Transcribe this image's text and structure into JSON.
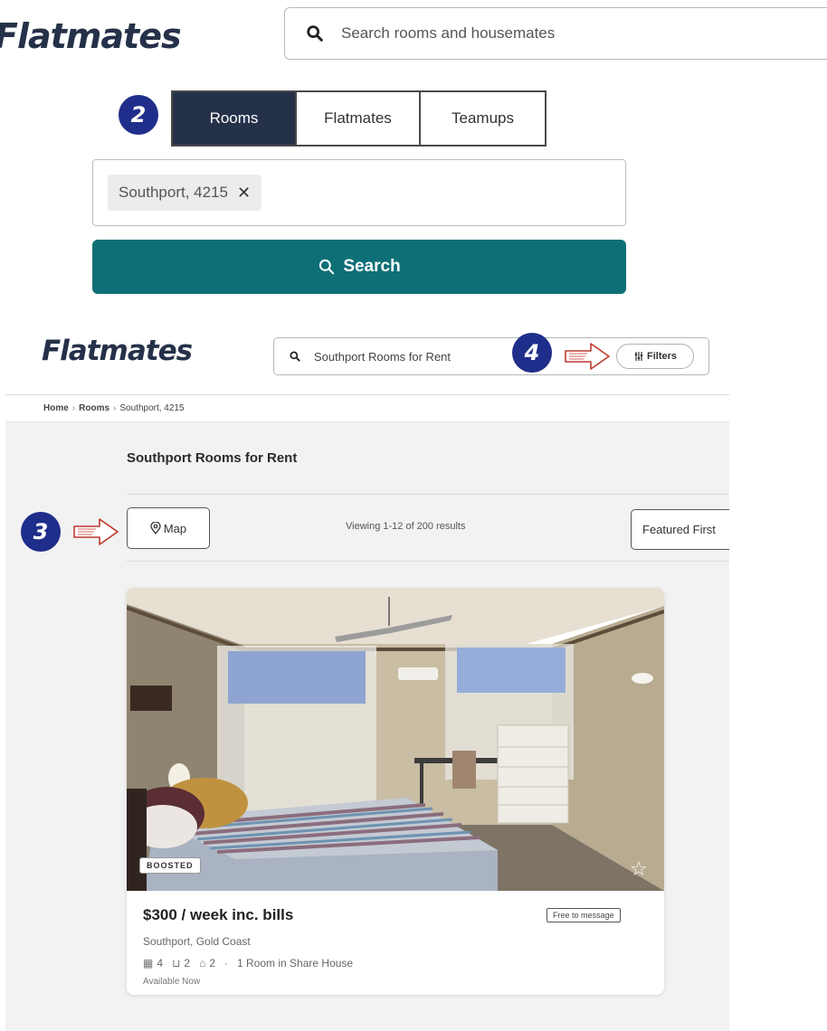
{
  "top": {
    "logo": "Flatmates",
    "search_placeholder": "Search rooms and housemates"
  },
  "steps": {
    "badge_2": "2",
    "badge_3": "3",
    "badge_4": "4"
  },
  "search_form": {
    "tabs": [
      {
        "label": "Rooms",
        "active": true
      },
      {
        "label": "Flatmates",
        "active": false
      },
      {
        "label": "Teamups",
        "active": false
      }
    ],
    "location_chip": "Southport, 4215",
    "search_button": "Search"
  },
  "header": {
    "logo": "Flatmates",
    "search_value": "Southport Rooms for Rent",
    "filters_label": "Filters"
  },
  "breadcrumb": [
    "Home",
    "Rooms",
    "Southport, 4215"
  ],
  "results": {
    "title": "Southport Rooms for Rent",
    "map_button": "Map",
    "viewing_text": "Viewing 1-12 of 200 results",
    "sort_label": "Featured First"
  },
  "listing": {
    "badge": "BOOSTED",
    "price": "$300 / week inc. bills",
    "free_to_message": "Free to message",
    "location": "Southport, Gold Coast",
    "bedrooms": "4",
    "bathrooms": "2",
    "parking": "2",
    "summary": "1 Room in Share House",
    "availability": "Available Now"
  },
  "colors": {
    "brand_navy": "#253149",
    "search_teal": "#0f6f76",
    "badge_blue": "#1f2e8a"
  }
}
